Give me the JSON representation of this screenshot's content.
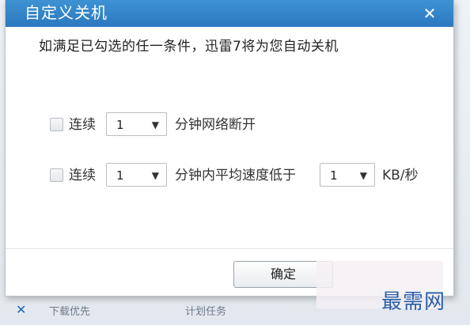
{
  "dialog": {
    "title": "自定义关机",
    "close_glyph": "✕",
    "description": "如满足已勾选的任一条件，迅雷7将为您自动关机"
  },
  "conditions": [
    {
      "checked": false,
      "prefix": "连续",
      "value": "1",
      "suffix": "分钟网络断开"
    },
    {
      "checked": false,
      "prefix": "连续",
      "value": "1",
      "middle": "分钟内平均速度低于",
      "speed_value": "1",
      "unit": "KB/秒"
    }
  ],
  "buttons": {
    "ok": "确定"
  },
  "underbar": {
    "icon": "download-icon",
    "text1": "下载优先",
    "text2": "计划任务"
  },
  "watermark": "最需网",
  "colors": {
    "titlebar": "#2f83c8",
    "watermark": "#2a5fa8"
  }
}
